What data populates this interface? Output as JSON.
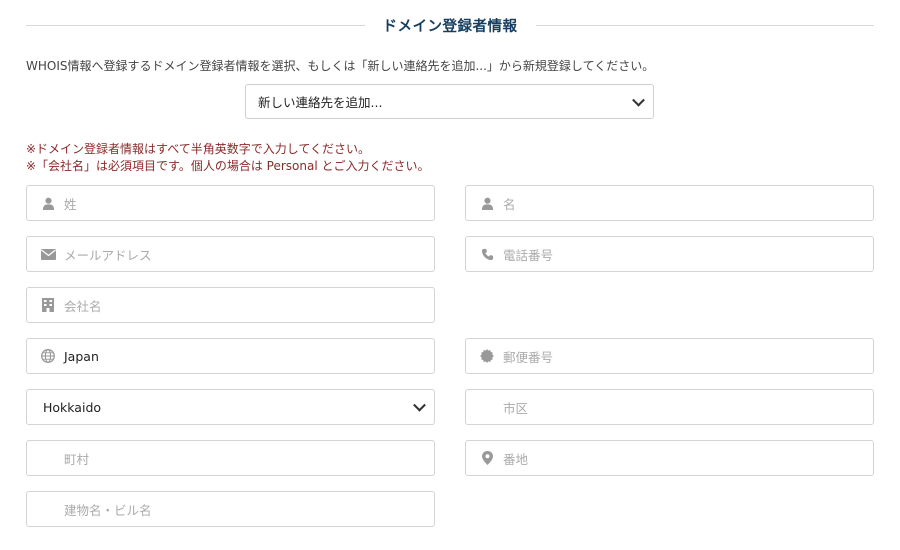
{
  "section": {
    "title": "ドメイン登録者情報"
  },
  "intro": "WHOIS情報へ登録するドメイン登録者情報を選択、もしくは「新しい連絡先を追加...」から新規登録してください。",
  "contact_select": {
    "value": "新しい連絡先を追加..."
  },
  "notes": [
    "※ドメイン登録者情報はすべて半角英数字で入力してください。",
    "※「会社名」は必須項目です。個人の場合は Personal とご入力ください。"
  ],
  "fields": {
    "last_name": {
      "placeholder": "姓",
      "icon": "user-icon"
    },
    "first_name": {
      "placeholder": "名",
      "icon": "user-icon"
    },
    "email": {
      "placeholder": "メールアドレス",
      "icon": "envelope-icon"
    },
    "phone": {
      "placeholder": "電話番号",
      "icon": "phone-icon"
    },
    "company": {
      "placeholder": "会社名",
      "icon": "building-icon"
    },
    "country": {
      "value": "Japan",
      "icon": "globe-icon"
    },
    "postal_code": {
      "placeholder": "郵便番号",
      "icon": "postal-seal-icon"
    },
    "prefecture": {
      "value": "Hokkaido"
    },
    "city": {
      "placeholder": "市区"
    },
    "town": {
      "placeholder": "町村"
    },
    "street": {
      "placeholder": "番地",
      "icon": "map-marker-icon"
    },
    "building": {
      "placeholder": "建物名・ビル名"
    }
  },
  "colors": {
    "title": "#173e5f",
    "note": "#8b2a2a",
    "placeholder": "#aaaaaa",
    "border": "#d4d4d4"
  }
}
